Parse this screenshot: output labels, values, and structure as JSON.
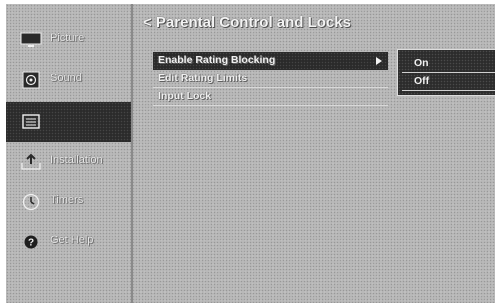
{
  "sidebar": {
    "items": [
      {
        "label": "Picture",
        "icon": "tv-icon"
      },
      {
        "label": "Sound",
        "icon": "speaker-icon"
      },
      {
        "label": "",
        "icon": "channels-icon",
        "selected": true
      },
      {
        "label": "Installation",
        "icon": "install-icon"
      },
      {
        "label": "Timers",
        "icon": "timer-icon"
      },
      {
        "label": "Get Help",
        "icon": "help-icon"
      }
    ]
  },
  "main": {
    "title": "< Parental Control and Locks",
    "menu": [
      {
        "label": "Enable Rating Blocking",
        "selected": true,
        "has_submenu": true
      },
      {
        "label": "Edit Rating Limits"
      },
      {
        "label": "Input Lock"
      }
    ]
  },
  "submenu": {
    "options": [
      "On",
      "Off"
    ]
  },
  "colors": {
    "background": "#b9b9b9",
    "selected": "#2a2a2a",
    "text": "#f0f0f0"
  }
}
